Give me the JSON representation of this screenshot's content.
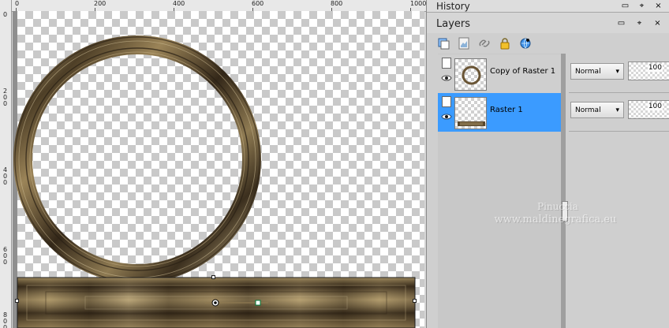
{
  "rulers": {
    "top_labels": [
      "0",
      "200",
      "400",
      "600",
      "800",
      "1000"
    ],
    "left_labels": [
      "0",
      "200",
      "400",
      "600",
      "800"
    ]
  },
  "canvas": {
    "preview": "frame-ring-and-base"
  },
  "history_panel": {
    "title": "History"
  },
  "layers_panel": {
    "title": "Layers",
    "toolbar_icons": [
      "layer-stack-icon",
      "mask-icon",
      "link-icon",
      "lock-icon",
      "globe-icon"
    ],
    "layers": [
      {
        "name": "Copy of Raster 1",
        "blend_mode": "Normal",
        "opacity": "100",
        "thumb": "ring-thumb",
        "selected": false
      },
      {
        "name": "Raster 1",
        "blend_mode": "Normal",
        "opacity": "100",
        "thumb": "base-thumb",
        "selected": true
      }
    ]
  },
  "watermark": {
    "line1": "Pinuccia",
    "line2": "www.maldinegrafica.eu"
  },
  "colors": {
    "selection_blue": "#3b9bff",
    "panel_gray": "#cfcfcf",
    "metal_dark": "#3a2e1f",
    "metal_mid": "#7c6a48",
    "metal_light": "#c8b488"
  }
}
